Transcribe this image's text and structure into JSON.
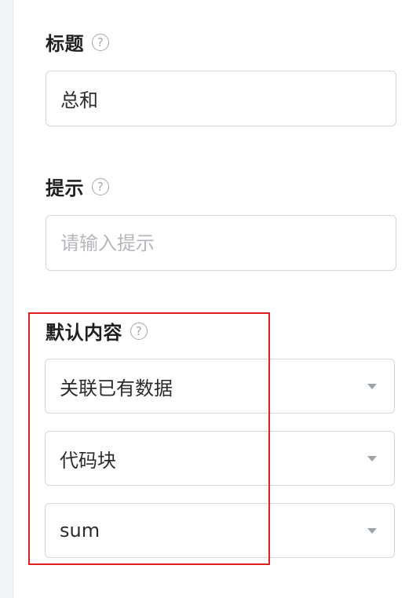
{
  "form": {
    "title_field": {
      "label": "标题",
      "help_glyph": "?",
      "value": "总和"
    },
    "hint_field": {
      "label": "提示",
      "help_glyph": "?",
      "value": "",
      "placeholder": "请输入提示"
    },
    "default_content": {
      "label": "默认内容",
      "help_glyph": "?",
      "selects": [
        {
          "value": "关联已有数据"
        },
        {
          "value": "代码块"
        },
        {
          "value": "sum"
        }
      ]
    }
  },
  "highlight": {
    "color": "#e02020"
  },
  "icons": {
    "help": "question-circle-icon",
    "caret": "caret-down-icon"
  }
}
